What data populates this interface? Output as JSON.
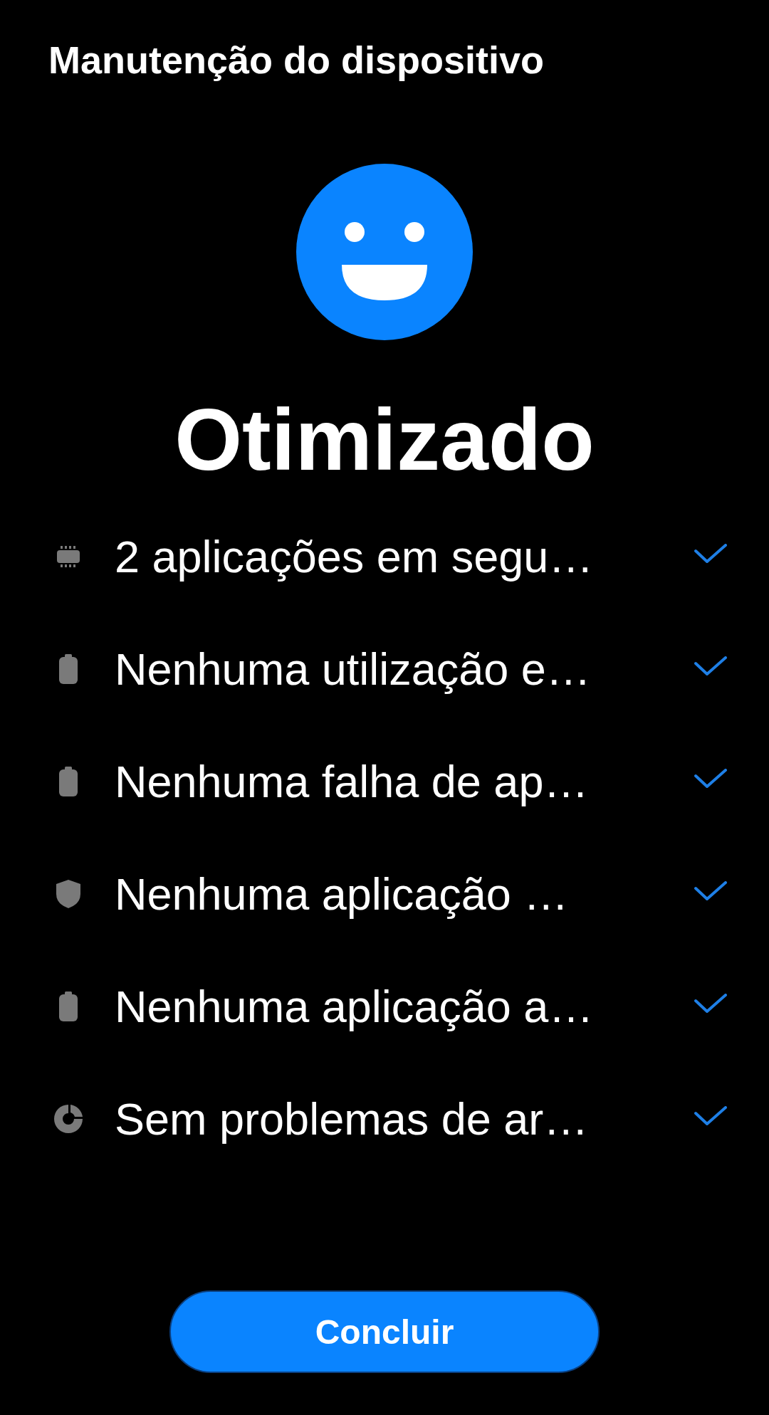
{
  "header": {
    "title": "Manutenção do dispositivo"
  },
  "status": {
    "title": "Otimizado"
  },
  "items": [
    {
      "kind": "memory",
      "text": "2 aplicações em segu…",
      "checked": true
    },
    {
      "kind": "battery",
      "text": "Nenhuma utilização e…",
      "checked": true
    },
    {
      "kind": "battery",
      "text": "Nenhuma falha de ap…",
      "checked": true
    },
    {
      "kind": "security",
      "text": "Nenhuma aplicação …",
      "checked": true
    },
    {
      "kind": "battery",
      "text": "Nenhuma aplicação a…",
      "checked": true
    },
    {
      "kind": "storage",
      "text": "Sem problemas de ar…",
      "checked": true
    }
  ],
  "button": {
    "label": "Concluir"
  }
}
